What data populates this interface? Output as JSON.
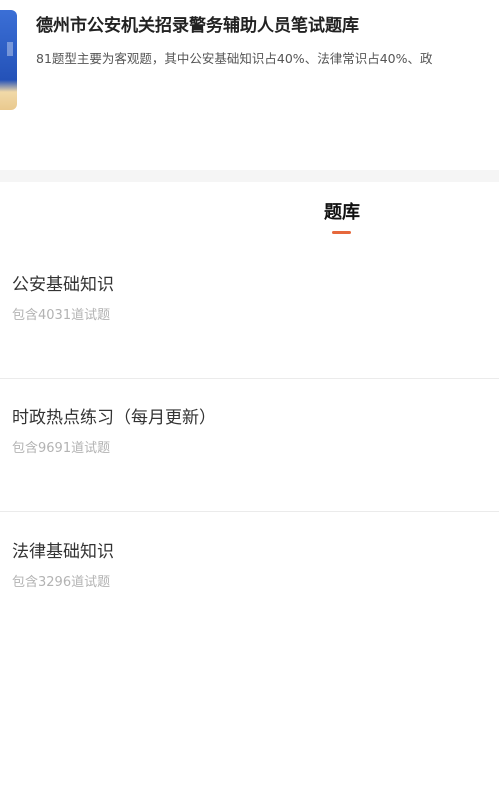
{
  "bank": {
    "title": "德州市公安机关招录警务辅助人员笔试题库",
    "description": "81题型主要为客观题，其中公安基础知识占40%、法律常识占40%、政"
  },
  "tabs": {
    "active_label": "题库"
  },
  "items": [
    {
      "title": "公安基础知识",
      "count_text": "包含4031道试题"
    },
    {
      "title": "时政热点练习（每月更新）",
      "count_text": "包含9691道试题"
    },
    {
      "title": "法律基础知识",
      "count_text": "包含3296道试题"
    }
  ],
  "colors": {
    "accent": "#e6683c"
  }
}
